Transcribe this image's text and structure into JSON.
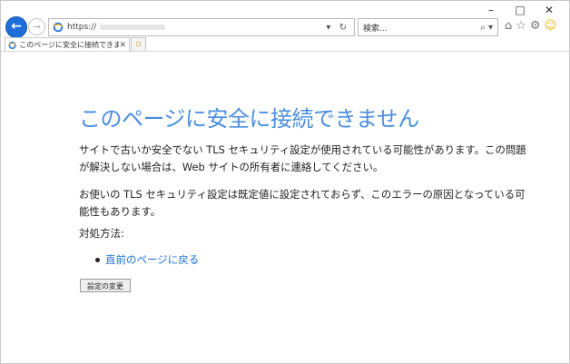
{
  "window": {
    "minimize": "–",
    "maximize": "□",
    "close": "✕"
  },
  "toolbar": {
    "url_prefix": "https://",
    "address_controls": "▾ ↻",
    "search_placeholder": "検索...",
    "search_controls": "⌕ ▾",
    "icons": [
      "home-icon",
      "favorites-star-icon",
      "settings-gear-icon",
      "feedback-smiley-icon"
    ]
  },
  "tab": {
    "title": "このページに安全に接続できま...",
    "close": "✕"
  },
  "page": {
    "title": "このページに安全に接続できません",
    "paragraph1": "サイトで古いか安全でない TLS セキュリティ設定が使用されている可能性があります。この問題が解決しない場合は、Web サイトの所有者に連絡してください。",
    "paragraph2": "お使いの TLS セキュリティ設定は既定値に設定されておらず、このエラーの原因となっている可能性もあります。",
    "howto_label": "対処方法:",
    "back_link": "直前のページに戻る",
    "settings_button": "設定の変更"
  }
}
